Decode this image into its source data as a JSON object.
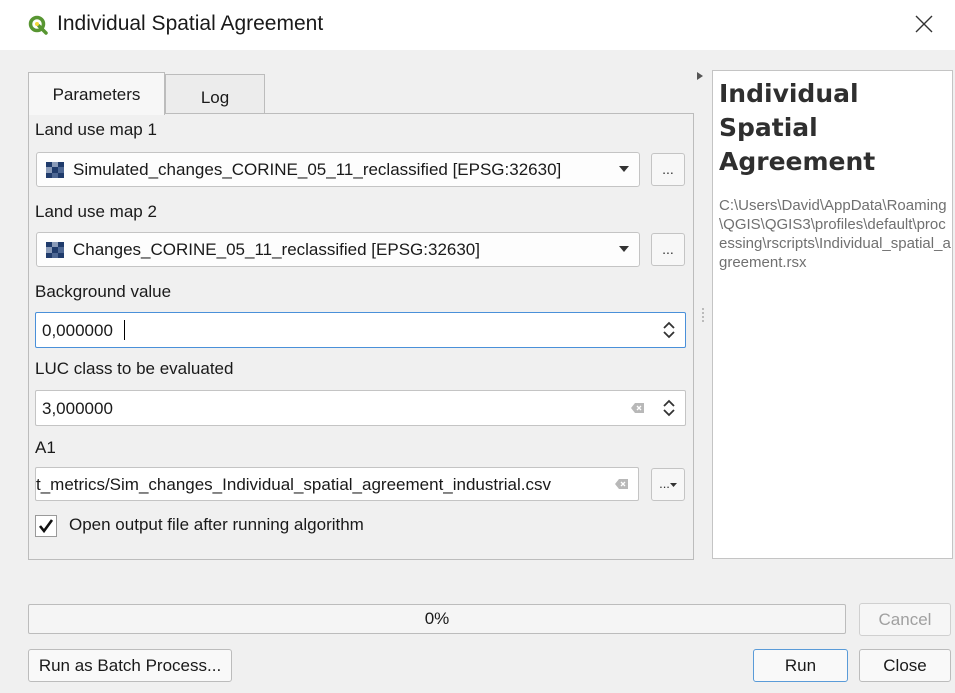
{
  "window": {
    "title": "Individual Spatial Agreement"
  },
  "tabs": [
    {
      "label": "Parameters",
      "active": true
    },
    {
      "label": "Log",
      "active": false
    }
  ],
  "params": {
    "land_use_map_1": {
      "label": "Land use map 1",
      "value": "Simulated_changes_CORINE_05_11_reclassified [EPSG:32630]"
    },
    "land_use_map_2": {
      "label": "Land use map 2",
      "value": "Changes_CORINE_05_11_reclassified [EPSG:32630]"
    },
    "background_value": {
      "label": "Background value",
      "value": "0,000000"
    },
    "luc_class": {
      "label": "LUC class to be evaluated",
      "value": "3,000000"
    },
    "a1": {
      "label": "A1",
      "value": "t_metrics/Sim_changes_Individual_spatial_agreement_industrial.csv"
    },
    "open_output": {
      "label": "Open output file after running algorithm",
      "checked": true
    },
    "browse_label": "..."
  },
  "help": {
    "title": "Individual Spatial Agreement",
    "path": "C:\\Users\\David\\AppData\\Roaming\\QGIS\\QGIS3\\profiles\\default\\processing\\rscripts\\Individual_spatial_agreement.rsx"
  },
  "progress": {
    "value": 0,
    "text": "0%"
  },
  "buttons": {
    "cancel": "Cancel",
    "batch": "Run as Batch Process...",
    "run": "Run",
    "close": "Close"
  },
  "colors": {
    "qgis_green": "#589632",
    "qgis_yellow": "#ee7913",
    "focus_blue": "#4a90d9"
  }
}
